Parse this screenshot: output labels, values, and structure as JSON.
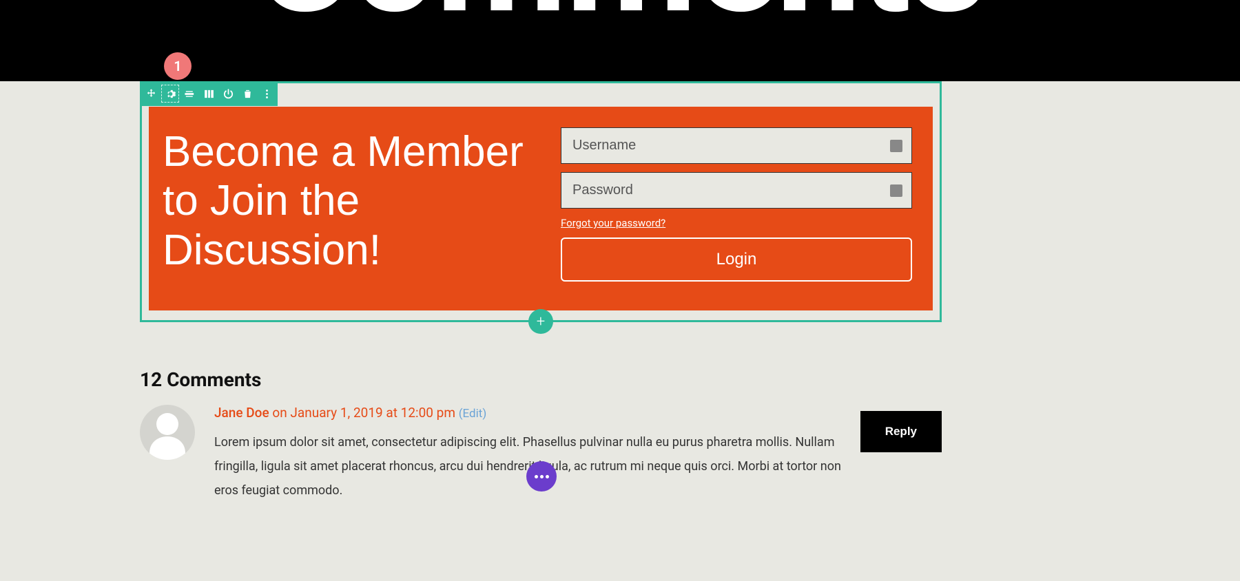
{
  "header": {
    "title": "Comments"
  },
  "callout": {
    "number": "1"
  },
  "cta": {
    "heading": "Become a Member to Join the Discussion!",
    "username_placeholder": "Username",
    "password_placeholder": "Password",
    "forgot_link": "Forgot your password?",
    "login_label": "Login"
  },
  "add_btn": {
    "glyph": "+"
  },
  "comments": {
    "title": "12 Comments",
    "items": [
      {
        "author": "Jane Doe",
        "date_prefix": " on ",
        "date": "January 1, 2019 at 12:00 pm",
        "edit_label": "(Edit)",
        "body": "Lorem ipsum dolor sit amet, consectetur adipiscing elit. Phasellus pulvinar nulla eu purus pharetra mollis. Nullam fringilla, ligula sit amet placerat rhoncus, arcu dui hendrerit ligula, ac rutrum mi neque quis orci. Morbi at tortor non eros feugiat commodo.",
        "reply_label": "Reply"
      }
    ]
  }
}
